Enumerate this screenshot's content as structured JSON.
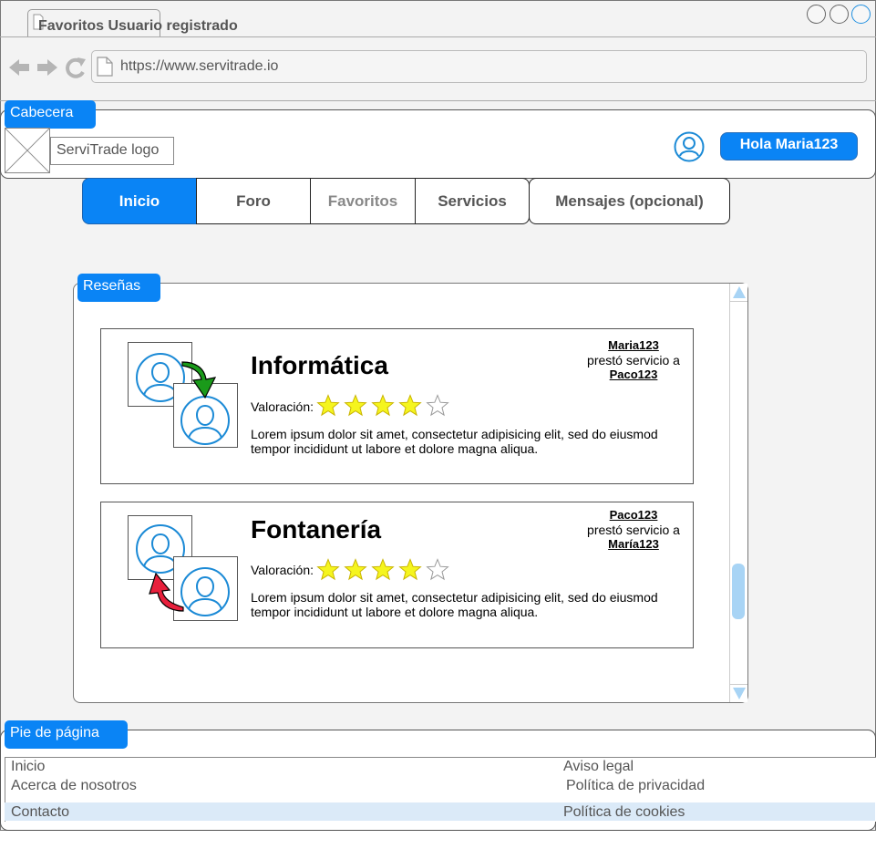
{
  "browser": {
    "tab_title": "Favoritos Usuario registrado",
    "url": "https://www.servitrade.io"
  },
  "header": {
    "section_label": "Cabecera",
    "logo_text": "ServiTrade logo",
    "greeting": "Hola Maria123"
  },
  "nav": {
    "tabs": [
      {
        "label": "Inicio"
      },
      {
        "label": "Foro"
      },
      {
        "label": "Favoritos"
      },
      {
        "label": "Servicios"
      },
      {
        "label": "Mensajes (opcional)"
      }
    ]
  },
  "reviews": {
    "section_label": "Reseñas",
    "rating_label": "Valoración:",
    "items": [
      {
        "category": "Informática",
        "provider": "Maria123",
        "middle_text": "prestó servicio a",
        "client": "Paco123",
        "rating": 4,
        "rating_max": 5,
        "text_line1": "Lorem ipsum dolor sit amet, consectetur adipisicing elit, sed do eiusmod",
        "text_line2": "tempor incididunt ut labore et dolore magna aliqua.",
        "arrow_color": "#1a9a1a"
      },
      {
        "category": "Fontanería",
        "provider": "Paco123",
        "middle_text": "prestó servicio a",
        "client": "María123",
        "rating": 4,
        "rating_max": 5,
        "text_line1": "Lorem ipsum dolor sit amet, consectetur adipisicing elit, sed do eiusmod",
        "text_line2": "tempor incididunt ut labore et dolore magna aliqua.",
        "arrow_color": "#e8203c"
      }
    ]
  },
  "footer": {
    "section_label": "Pie de página",
    "links_left": [
      "Inicio",
      "Acerca de nosotros",
      "Contacto"
    ],
    "links_right": [
      "Aviso legal",
      "Política de privacidad",
      "Política de cookies"
    ]
  },
  "colors": {
    "accent": "#0a84f5",
    "star_fill": "#f5f51e",
    "avatar_stroke": "#1b8ad6",
    "scrollbar": "#a8d4f5"
  }
}
